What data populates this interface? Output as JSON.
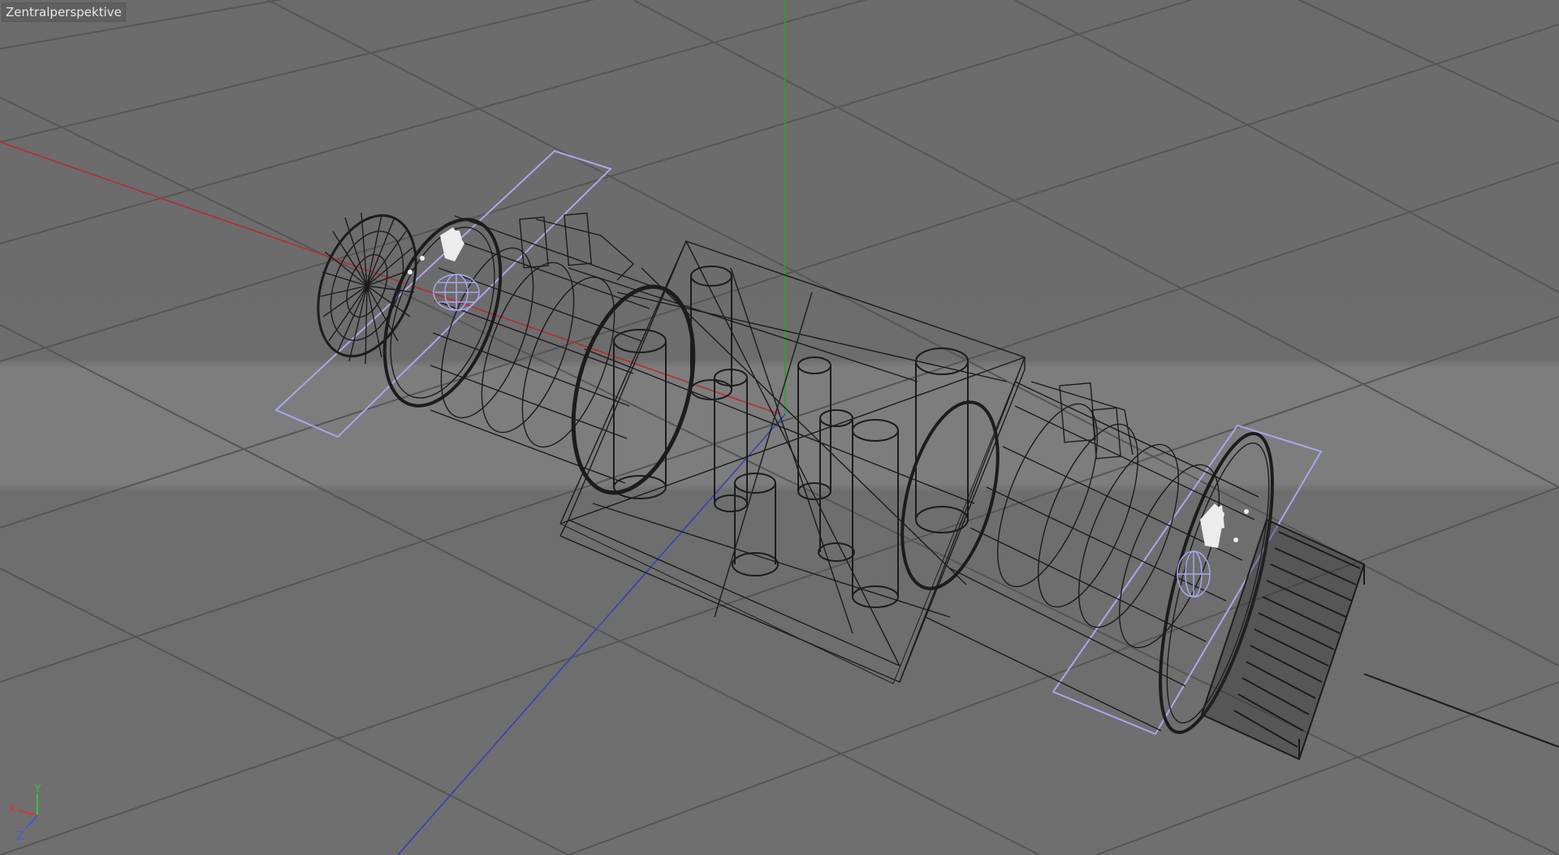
{
  "viewport": {
    "label": "Zentralperspektive"
  },
  "axis_gizmo": {
    "x_label": "X",
    "y_label": "Y",
    "z_label": "Z",
    "x_color": "#d23a3a",
    "y_color": "#3fbf3f",
    "z_color": "#4a55d8"
  },
  "colors": {
    "grid": "#565656",
    "x_axis": "#b33030",
    "y_axis": "#2fa02f",
    "z_axis": "#3b40b8",
    "wire": "#1c1c1c",
    "selection": "#a9a6ee",
    "highlight": "#ececec"
  },
  "icons": {
    "gizmo": "axis-gizmo-icon"
  }
}
